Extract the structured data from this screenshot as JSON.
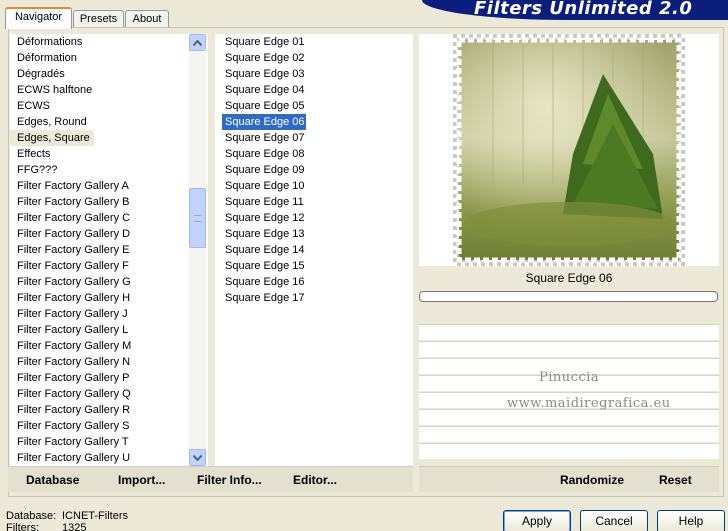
{
  "tabs": [
    {
      "label": "Navigator",
      "active": true
    },
    {
      "label": "Presets",
      "active": false
    },
    {
      "label": "About",
      "active": false
    }
  ],
  "banner_title": "Filters Unlimited 2.0",
  "categories": {
    "items": [
      "Déformations",
      "Déformation",
      "Dégradés",
      "ECWS halftone",
      "ECWS",
      "Edges, Round",
      "Edges, Square",
      "Effects",
      "FFG???",
      "Filter Factory Gallery A",
      "Filter Factory Gallery B",
      "Filter Factory Gallery C",
      "Filter Factory Gallery D",
      "Filter Factory Gallery E",
      "Filter Factory Gallery F",
      "Filter Factory Gallery G",
      "Filter Factory Gallery H",
      "Filter Factory Gallery J",
      "Filter Factory Gallery L",
      "Filter Factory Gallery M",
      "Filter Factory Gallery N",
      "Filter Factory Gallery P",
      "Filter Factory Gallery Q",
      "Filter Factory Gallery R",
      "Filter Factory Gallery S",
      "Filter Factory Gallery T",
      "Filter Factory Gallery U"
    ],
    "selected": "Edges, Square"
  },
  "filters": {
    "items": [
      "Square Edge 01",
      "Square Edge 02",
      "Square Edge 03",
      "Square Edge 04",
      "Square Edge 05",
      "Square Edge 06",
      "Square Edge 07",
      "Square Edge 08",
      "Square Edge 09",
      "Square Edge 10",
      "Square Edge 11",
      "Square Edge 12",
      "Square Edge 13",
      "Square Edge 14",
      "Square Edge 15",
      "Square Edge 16",
      "Square Edge 17"
    ],
    "selected": "Square Edge 06"
  },
  "preview": {
    "caption": "Square Edge 06",
    "watermark_line1": "Pinuccia",
    "watermark_line2": "www.maidiregrafica.eu"
  },
  "toolbar": {
    "database_label": "Database",
    "import_label": "Import...",
    "filter_info_label": "Filter Info...",
    "editor_label": "Editor...",
    "randomize_label": "Randomize",
    "reset_label": "Reset"
  },
  "status": {
    "database_label": "Database:",
    "database_value": "ICNET-Filters",
    "filters_label": "Filters:",
    "filters_value": "1325"
  },
  "dialog_buttons": {
    "apply": "Apply",
    "cancel": "Cancel",
    "help": "Help"
  },
  "colors": {
    "selection_blue": "#316ac5",
    "banner_navy": "#0b1e7e",
    "window_bg": "#ece9d8"
  }
}
